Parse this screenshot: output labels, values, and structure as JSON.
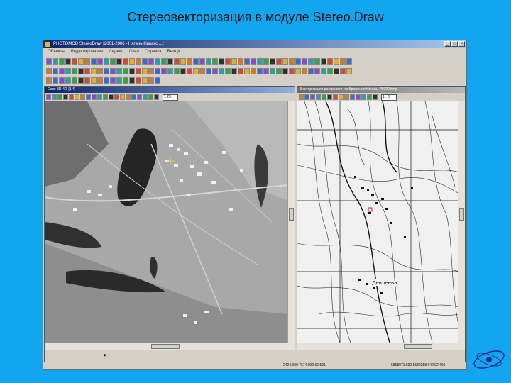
{
  "slide": {
    "title": "Стереовекторизация в модуле Stereo.Draw"
  },
  "app": {
    "title": "PHOTOMOD StereoDraw [2001-2006 - Нягань-Нивакс ...]",
    "menu": [
      "Объекты",
      "Редактирование",
      "Сервис",
      "Окна",
      "Справка",
      "Выход"
    ]
  },
  "left_window": {
    "title": "Окно 3D-4/3 [1:4]",
    "zoom_field": "1:23"
  },
  "right_window": {
    "title": "Векторизация растрового изображения Нягань, 25000.bmp",
    "scale_field": "1 : 8"
  },
  "map_labels": {
    "town": "Девлеева"
  },
  "statusbar": {
    "coords_left": "2424.000 7674.000 66.521",
    "coords_right": "6858071.590 5689258.642 92.495"
  },
  "colors": {
    "background": "#12a6f0",
    "window_gray": "#d4d0c8",
    "titlebar_active": "#0a246a"
  }
}
